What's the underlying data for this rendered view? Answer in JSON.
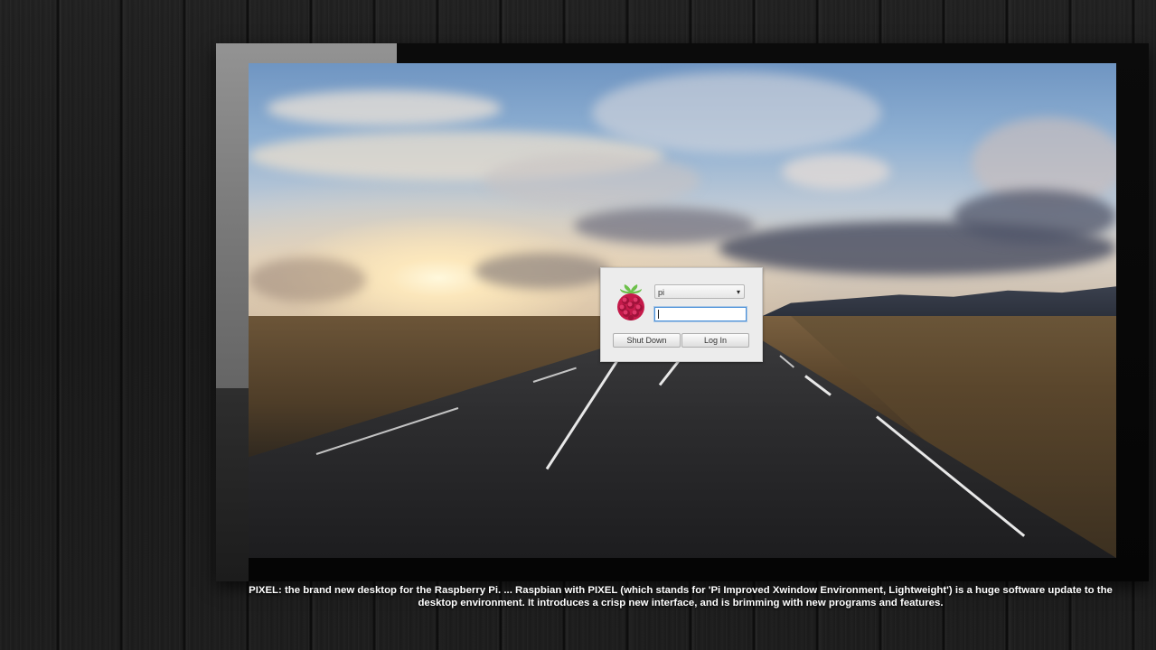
{
  "login": {
    "username_value": "pi",
    "password_value": "",
    "shutdown_label": "Shut Down",
    "login_label": "Log In"
  },
  "caption": "PIXEL: the brand new desktop for the Raspberry Pi. ... Raspbian with PIXEL (which stands for 'Pi Improved Xwindow Environment, Lightweight') is a huge software update to the desktop environment. It introduces a crisp new interface, and is brimming with new programs and features.",
  "icons": {
    "logo": "raspberry-pi-logo",
    "dropdown": "chevron-down-icon"
  },
  "colors": {
    "focus_border": "#4a90d9",
    "raspberry_red": "#c51a4a",
    "leaf_green": "#6cc04a"
  }
}
